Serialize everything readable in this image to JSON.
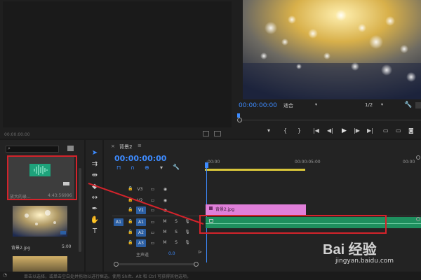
{
  "source_monitor": {
    "timecode": "00:00:00:00"
  },
  "program_monitor": {
    "timecode": "00:00:00:00",
    "fit": "适合",
    "resolution": "1/2"
  },
  "project": {
    "search_placeholder": "",
    "items": [
      {
        "name": "放大的录...",
        "duration": "4:43:56996",
        "type": "audio"
      },
      {
        "name": "背景2.jpg",
        "duration": "5:00",
        "type": "image"
      }
    ]
  },
  "timeline": {
    "sequence_name": "背景2",
    "menu_glyph": "≡",
    "timecode": "00:00:00:00",
    "ruler": [
      ":00:00",
      "00:00:05:00",
      "00:00"
    ],
    "video_tracks": [
      "V3",
      "V2",
      "V1"
    ],
    "audio_tracks": [
      "A1",
      "A2",
      "A3"
    ],
    "source_target": "A1",
    "master_label": "主声道",
    "master_value": "0.0",
    "clips": {
      "video_clip": "背景2.jpg",
      "audio_clip": ""
    }
  },
  "status_bar": {
    "text": "单击以选择，或单击空白处并拖动以进行框选。使用 Shift、Alt 和 Ctrl 可获得其他选项。"
  },
  "watermark": {
    "brand": "Bai 经验",
    "url": "jingyan.baidu.com"
  },
  "colors": {
    "accent_blue": "#3d8bff",
    "video_clip": "#e07fd9",
    "audio_clip": "#1e8f5e",
    "annotation_red": "#d4232b"
  }
}
